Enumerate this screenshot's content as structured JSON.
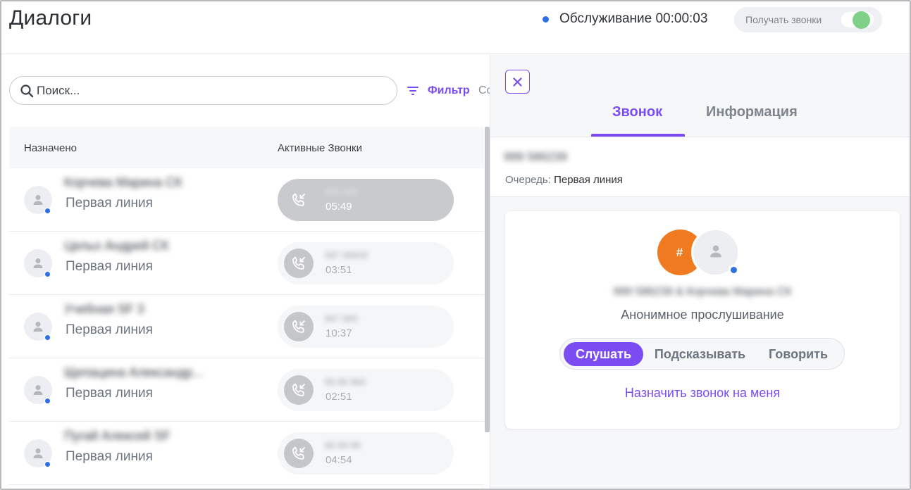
{
  "header": {
    "title": "Диалоги",
    "status_text": "Обслуживание 00:00:03",
    "status_color": "#2f6fe4",
    "toggle_label": "Получать звонки",
    "toggle_on": true,
    "toggle_color": "#7fd18a"
  },
  "toolbar": {
    "search_placeholder": "Поиск...",
    "filter_label": "Фильтр",
    "sort_label_partial": "Со"
  },
  "table": {
    "columns": [
      "Назначено",
      "Активные Звонки"
    ],
    "rows": [
      {
        "agent_name": "Корчева Марина СК",
        "queue": "Первая линия",
        "call_number": "999 586",
        "call_time": "05:49",
        "active": true
      },
      {
        "agent_name": "Цельо Андрей СК",
        "queue": "Первая линия",
        "call_number": "587 88835",
        "call_time": "03:51",
        "active": false
      },
      {
        "agent_name": "Учебная SF 3",
        "queue": "Первая линия",
        "call_number": "897 885",
        "call_time": "10:37",
        "active": false
      },
      {
        "agent_name": "Щепацина Александр...",
        "queue": "Первая линия",
        "call_number": "89 89 880",
        "call_time": "02:51",
        "active": false
      },
      {
        "agent_name": "Пугай Алексей SF",
        "queue": "Первая линия",
        "call_number": "88 89 88",
        "call_time": "04:54",
        "active": false
      }
    ]
  },
  "panel": {
    "tabs": [
      {
        "label": "Звонок",
        "active": true
      },
      {
        "label": "Информация",
        "active": false
      }
    ],
    "caller_number": "999 586239",
    "queue_label": "Очередь:",
    "queue_value": "Первая линия",
    "card": {
      "hash_symbol": "#",
      "participants": "999 586239 & Корчева Марина СК",
      "mode_text": "Анонимное прослушивание",
      "modes": [
        "Слушать",
        "Подсказывать",
        "Говорить"
      ],
      "selected_mode": "Слушать",
      "assign_link": "Назначить звонок на меня"
    },
    "accent_color": "#7a4cf2",
    "hash_color": "#f07a1f"
  }
}
